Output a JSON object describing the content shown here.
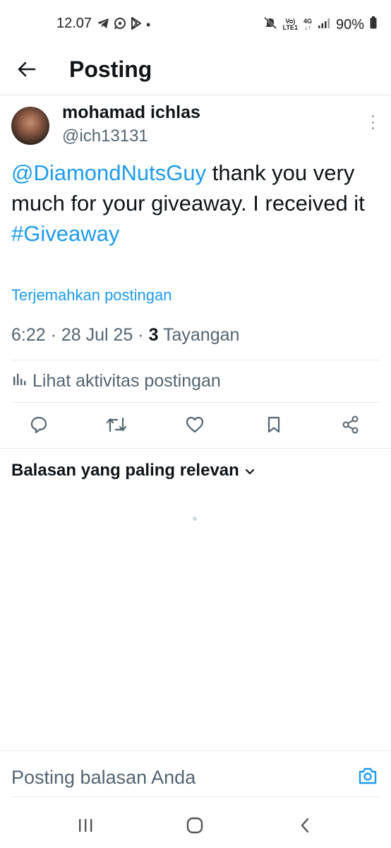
{
  "status_bar": {
    "time": "12.07",
    "dot": "•",
    "network_top": "Vo)",
    "network_bottom": "LTE1",
    "network_type": "4G",
    "battery": "90%"
  },
  "header": {
    "title": "Posting"
  },
  "post": {
    "author_name": "mohamad ichlas",
    "author_handle": "@ich13131",
    "mention": "@DiamondNutsGuy",
    "text_body": " thank you very much for your giveaway. I received it",
    "hashtag": "#Giveaway",
    "translate_label": "Terjemahkan postingan",
    "time": "6:22",
    "separator": " · ",
    "date": "28 Jul 25",
    "views_count": "3",
    "views_label": "Tayangan",
    "activity_label": "Lihat aktivitas postingan"
  },
  "replies": {
    "sort_label": "Balasan yang paling relevan"
  },
  "reply_bar": {
    "placeholder": "Posting balasan Anda"
  },
  "colors": {
    "accent": "#1d9bf0",
    "text": "#0f1419",
    "muted": "#536471",
    "divider": "#e6e9eb"
  },
  "icons": {
    "status_left": [
      "telegram-icon",
      "whatsapp-icon",
      "play-store-icon"
    ],
    "status_right": [
      "mute-icon",
      "signal-icon",
      "battery-icon"
    ],
    "actions": [
      "reply-icon",
      "repost-icon",
      "like-icon",
      "bookmark-icon",
      "share-icon"
    ],
    "nav": [
      "recent-apps-icon",
      "home-icon",
      "back-icon"
    ]
  }
}
